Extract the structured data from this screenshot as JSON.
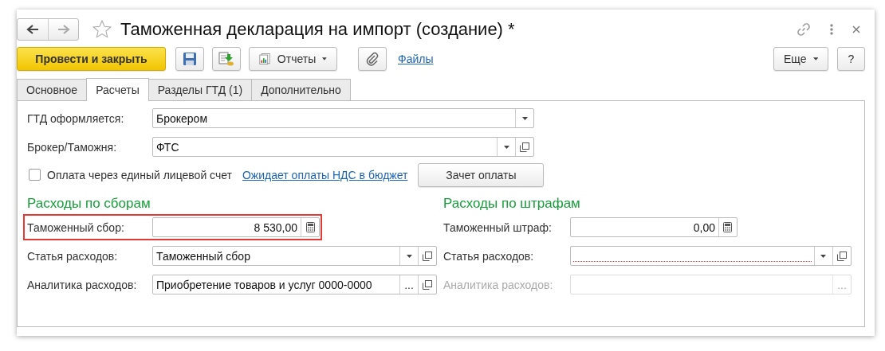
{
  "window": {
    "title": "Таможенная декларация на импорт (создание) *",
    "nav": [
      {
        "kind": "back",
        "disabled": false
      },
      {
        "kind": "forward",
        "disabled": true
      }
    ],
    "favorite": false
  },
  "toolbar": {
    "primary": "Провести и закрыть",
    "reports": "Отчеты",
    "files_link": "Файлы",
    "more": "Еще",
    "help": "?"
  },
  "tabs": [
    {
      "label": "Основное",
      "selected": false
    },
    {
      "label": "Расчеты",
      "selected": true
    },
    {
      "label": "Разделы ГТД (1)",
      "selected": false
    },
    {
      "label": "Дополнительно",
      "selected": false
    }
  ],
  "top_fields": [
    {
      "label": "ГТД оформляется:",
      "value": "Брокером",
      "buttons": [
        {
          "kind": "dropdown"
        }
      ]
    },
    {
      "label": "Брокер/Таможня:",
      "value": "ФТС",
      "buttons": [
        {
          "kind": "dropdown"
        },
        {
          "kind": "open"
        }
      ]
    }
  ],
  "payment_row": {
    "checkbox": {
      "label": "Оплата через единый лицевой счет",
      "checked": false
    },
    "link": "Ожидает оплаты НДС в бюджет",
    "button": "Зачет оплаты"
  },
  "sections": [
    {
      "title": "Расходы по сборам",
      "fields": [
        {
          "kind": "amount",
          "label": "Таможенный сбор:",
          "value": "8 530,00",
          "highlighted": true,
          "required": false,
          "disabled": false,
          "buttons": [
            {
              "kind": "calculator"
            }
          ]
        },
        {
          "kind": "select",
          "label": "Статья расходов:",
          "value": "Таможенный сбор",
          "highlighted": false,
          "required": false,
          "disabled": false,
          "buttons": [
            {
              "kind": "dropdown"
            },
            {
              "kind": "open"
            }
          ]
        },
        {
          "kind": "select",
          "label": "Аналитика расходов:",
          "value": "Приобретение товаров и услуг 0000-0000",
          "highlighted": false,
          "required": false,
          "disabled": false,
          "buttons": [
            {
              "kind": "ellipsis",
              "text": "..."
            },
            {
              "kind": "open"
            }
          ]
        }
      ]
    },
    {
      "title": "Расходы по штрафам",
      "fields": [
        {
          "kind": "amount",
          "label": "Таможенный штраф:",
          "value": "0,00",
          "highlighted": false,
          "required": false,
          "disabled": false,
          "buttons": [
            {
              "kind": "calculator"
            }
          ]
        },
        {
          "kind": "select",
          "label": "Статья расходов:",
          "highlighted": false,
          "required": true,
          "disabled": false,
          "buttons": [
            {
              "kind": "dropdown"
            },
            {
              "kind": "open"
            }
          ]
        },
        {
          "kind": "select",
          "label": "Аналитика расходов:",
          "highlighted": false,
          "required": false,
          "disabled": true,
          "buttons": [
            {
              "kind": "ellipsis",
              "text": "..."
            }
          ]
        }
      ]
    }
  ]
}
